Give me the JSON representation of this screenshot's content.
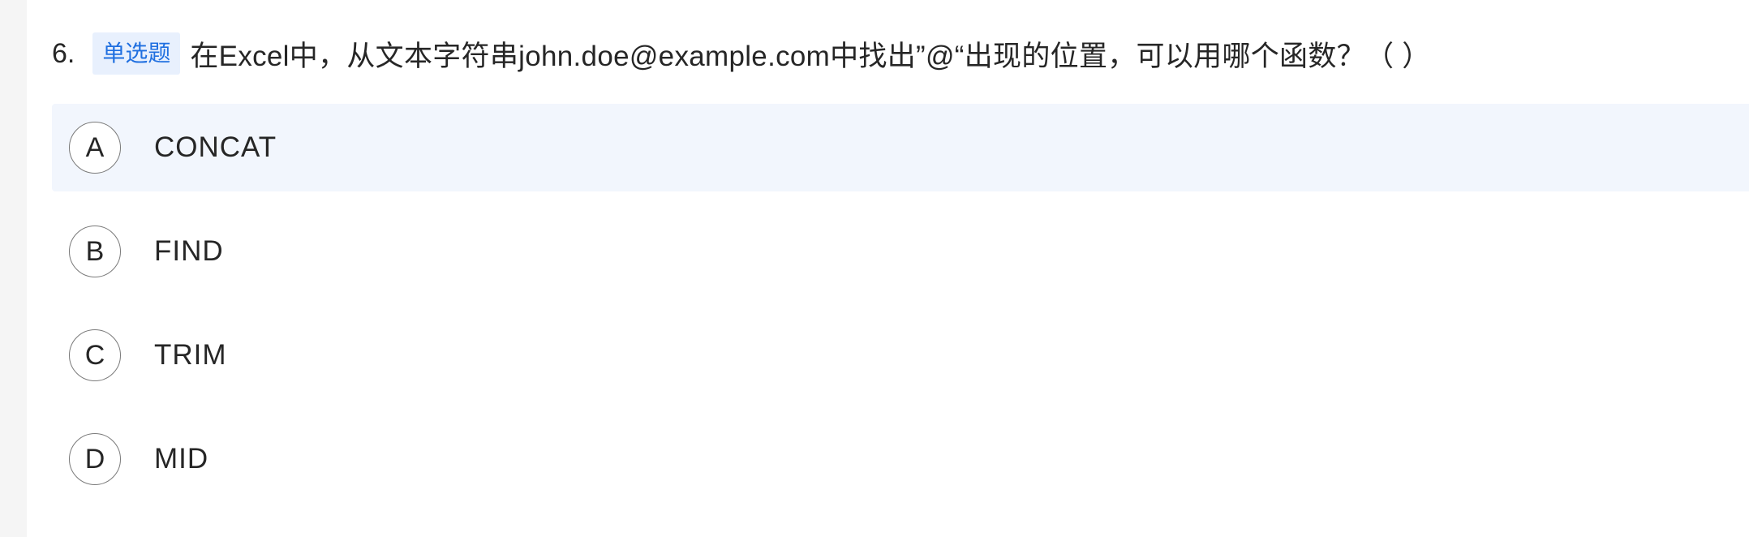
{
  "question": {
    "number": "6.",
    "type_badge": "单选题",
    "text": "在Excel中，从文本字符串john.doe@example.com中找出”@“出现的位置，可以用哪个函数？（ ）"
  },
  "options": [
    {
      "letter": "A",
      "text": "CONCAT"
    },
    {
      "letter": "B",
      "text": "FIND"
    },
    {
      "letter": "C",
      "text": "TRIM"
    },
    {
      "letter": "D",
      "text": "MID"
    }
  ],
  "state": {
    "highlighted_option": "A"
  },
  "colors": {
    "badge_bg": "#e8f0fd",
    "badge_text": "#1f6fe0",
    "highlight_bg": "#f2f6fd",
    "gutter": "#f5f5f5"
  }
}
